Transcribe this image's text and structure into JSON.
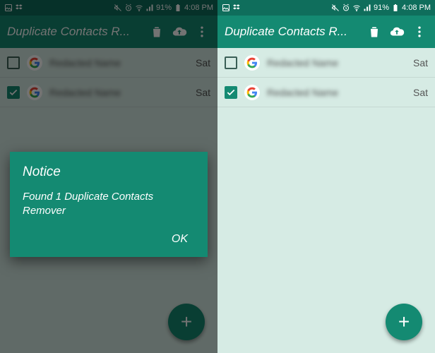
{
  "statusbar": {
    "battery_text": "91%",
    "time": "4:08 PM"
  },
  "appbar": {
    "title": "Duplicate Contacts R..."
  },
  "contacts": [
    {
      "name_blurred": "Redacted Name",
      "suffix": "Sat",
      "checked": false
    },
    {
      "name_blurred": "Redacted Name",
      "suffix": "Sat",
      "checked": true
    }
  ],
  "dialog": {
    "title": "Notice",
    "body": "Found 1 Duplicate Contacts Remover",
    "ok": "OK"
  },
  "fab": {
    "glyph": "+"
  }
}
